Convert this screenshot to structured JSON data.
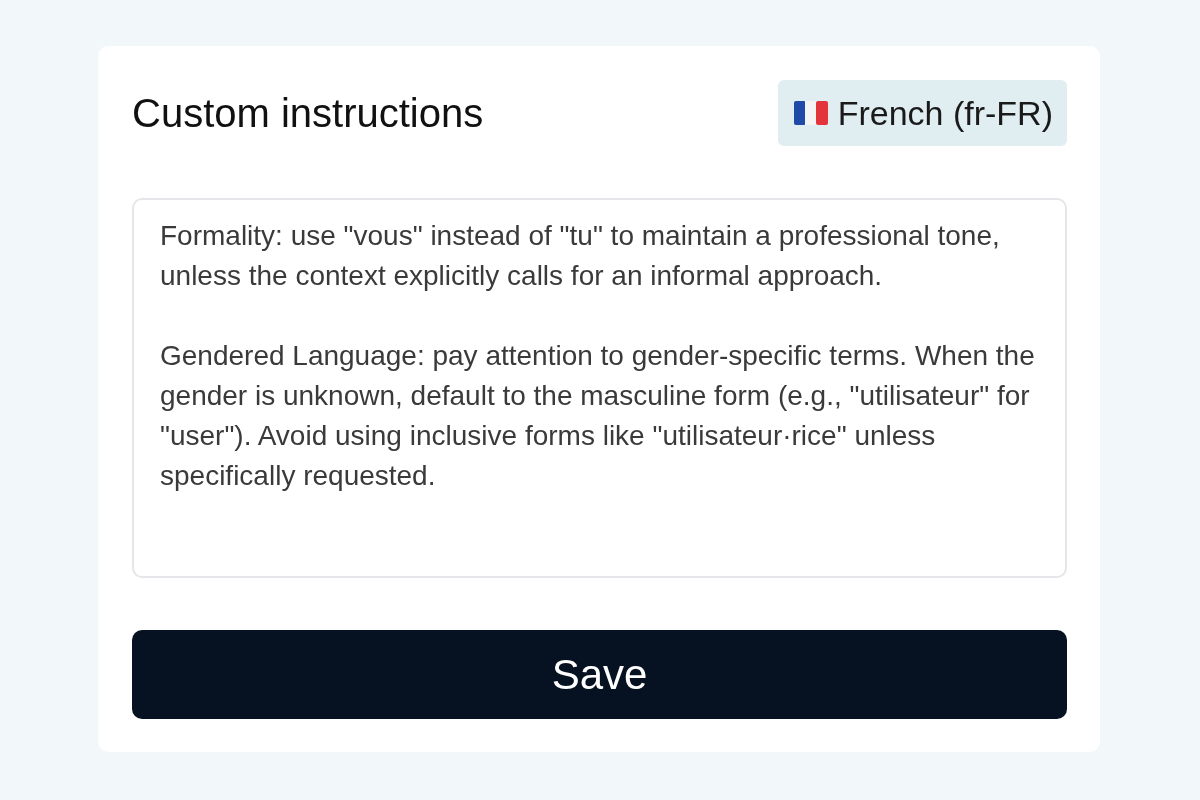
{
  "title": "Custom instructions",
  "language": {
    "label": "French (fr-FR)"
  },
  "instructions": {
    "value": "Formality: use \"vous\" instead of \"tu\" to maintain a professional tone, unless the context explicitly calls for an informal approach.\n\nGendered Language: pay attention to gender-specific terms. When the gender is unknown, default to the masculine form (e.g., \"utilisateur\" for \"user\"). Avoid using inclusive forms like \"utilisateur·rice\" unless specifically requested."
  },
  "save_button": {
    "label": "Save"
  }
}
